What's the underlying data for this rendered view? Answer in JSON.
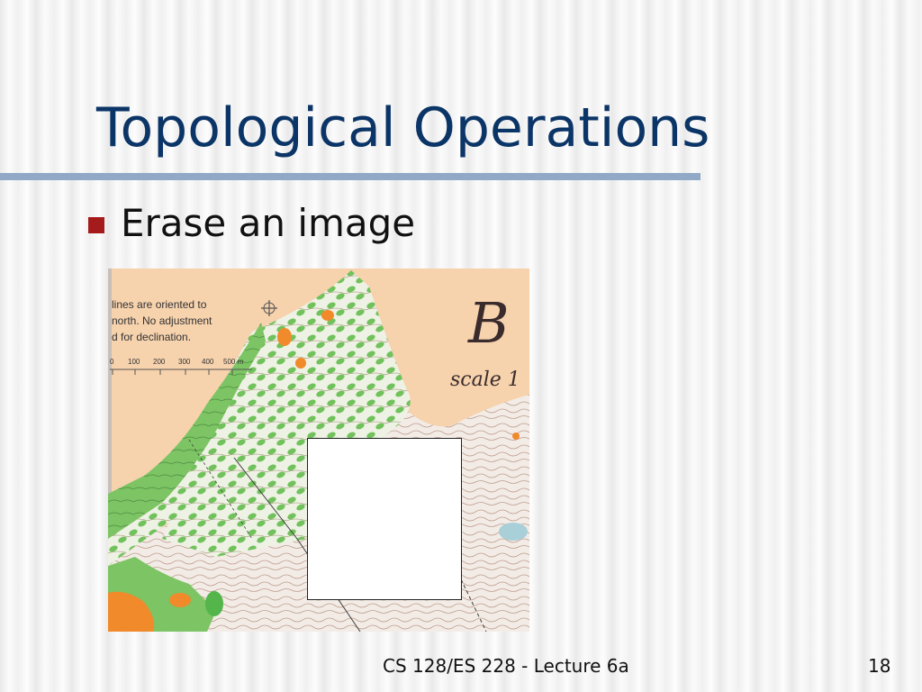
{
  "slide": {
    "title": "Topological Operations",
    "bullets": [
      {
        "text": "Erase an image"
      }
    ],
    "footer": "CS 128/ES 228 - Lecture 6a",
    "page_number": "18"
  },
  "map_image": {
    "legend_lines": [
      "lines are oriented to",
      "north.  No adjustment",
      "d for declination."
    ],
    "scale_ticks": [
      "0",
      "100",
      "200",
      "300",
      "400",
      "500 m"
    ],
    "scale_text": "scale 1",
    "logo_letter": "B"
  },
  "colors": {
    "title": "#0c3567",
    "rule": "#91a9c7",
    "bullet": "#a51a1a",
    "map_paper": "#f6d2ad",
    "map_green": "#6fc35a",
    "map_orange": "#f08a2a"
  }
}
